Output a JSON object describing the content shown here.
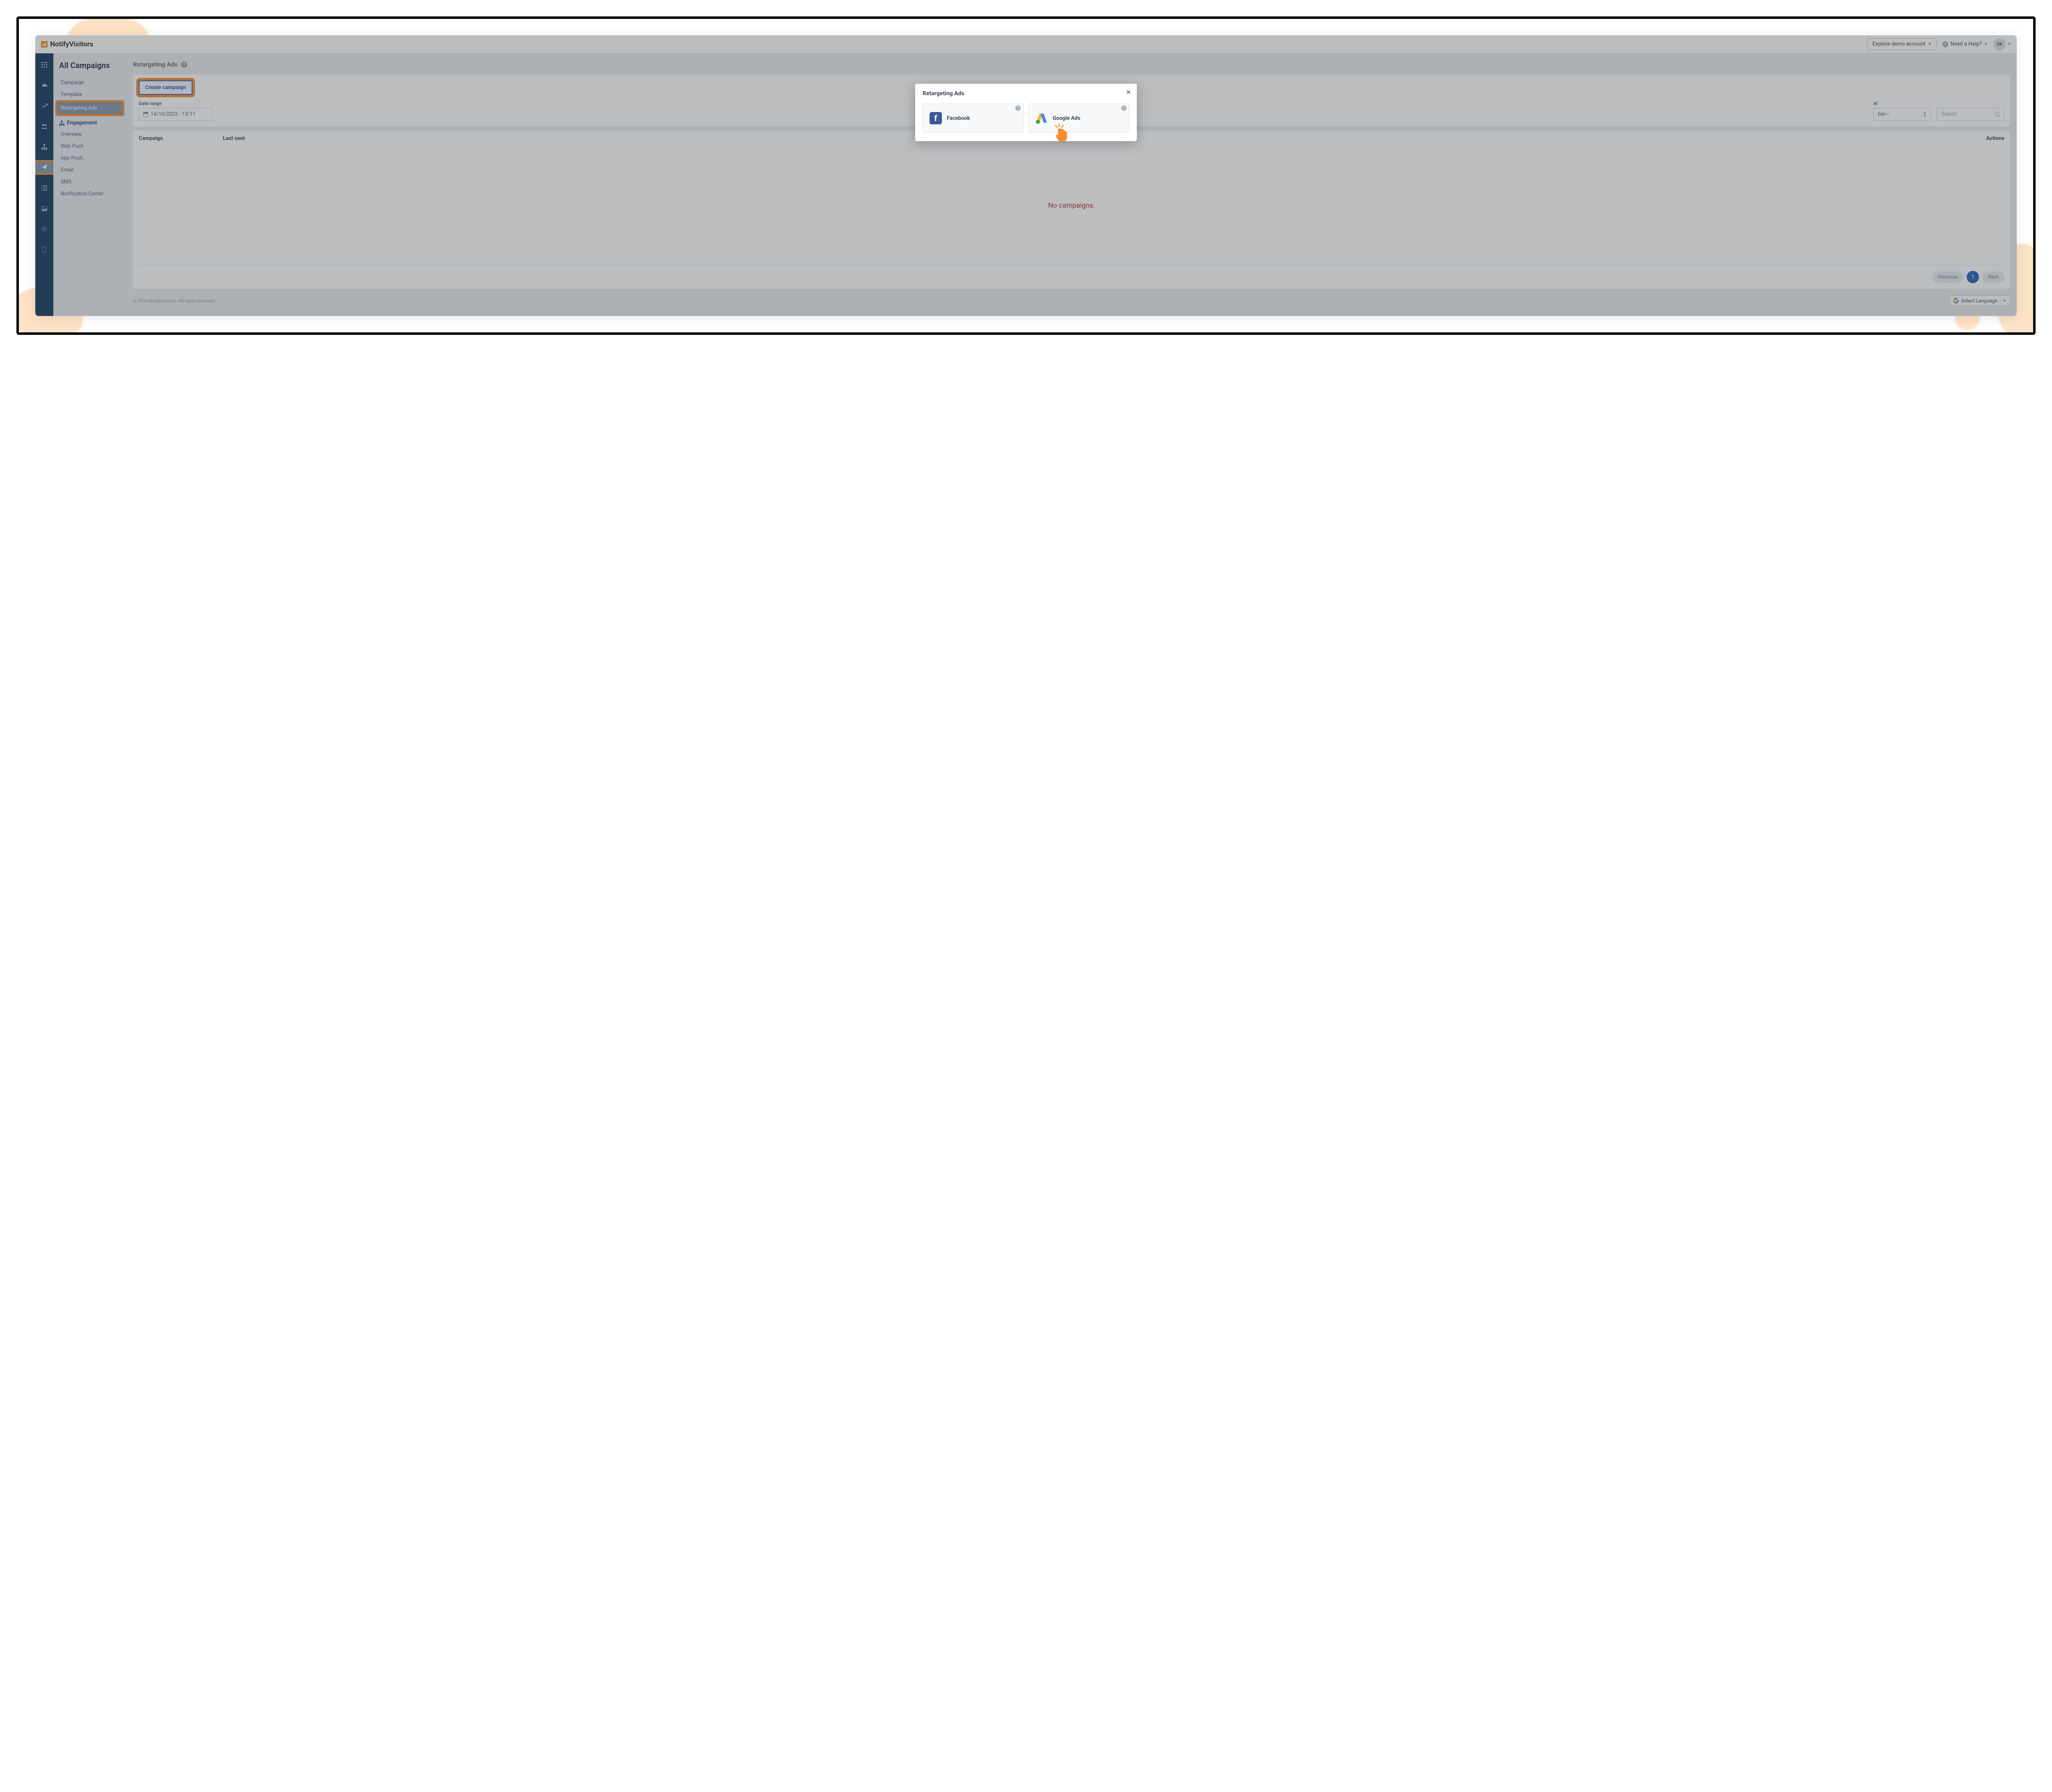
{
  "brand": "NotifyVisitors",
  "topbar": {
    "explore": "Explore demo account",
    "help": "Need a Help?",
    "avatar": "DK"
  },
  "sidebar": {
    "title": "All Campaigns",
    "items1": [
      "Campaign",
      "Template",
      "Retargeting Ads"
    ],
    "section": "Engagement",
    "items2": [
      "Overview",
      "Web Push",
      "App Push",
      "Email",
      "SMS",
      "Notification Center"
    ]
  },
  "page": {
    "title": "Retargeting Ads",
    "create": "Create campaign",
    "date_label": "Date range",
    "date_value": "14/10/2023 - 13/11",
    "label_label": "el",
    "label_value": "bel---",
    "search_placeholder": "Search",
    "cols": {
      "c1": "Campaign",
      "c2": "Last sent",
      "c3": "Actions"
    },
    "empty": "No campaigns.",
    "prev": "Previous",
    "page_num": "1",
    "next": "Next"
  },
  "footer": {
    "copyright": "© 2014 NotifyVisitors. All rights reserved.",
    "lang": "Select Language"
  },
  "modal": {
    "title": "Retargeting Ads",
    "opt_fb": "Facebook",
    "opt_gads": "Google Ads"
  }
}
